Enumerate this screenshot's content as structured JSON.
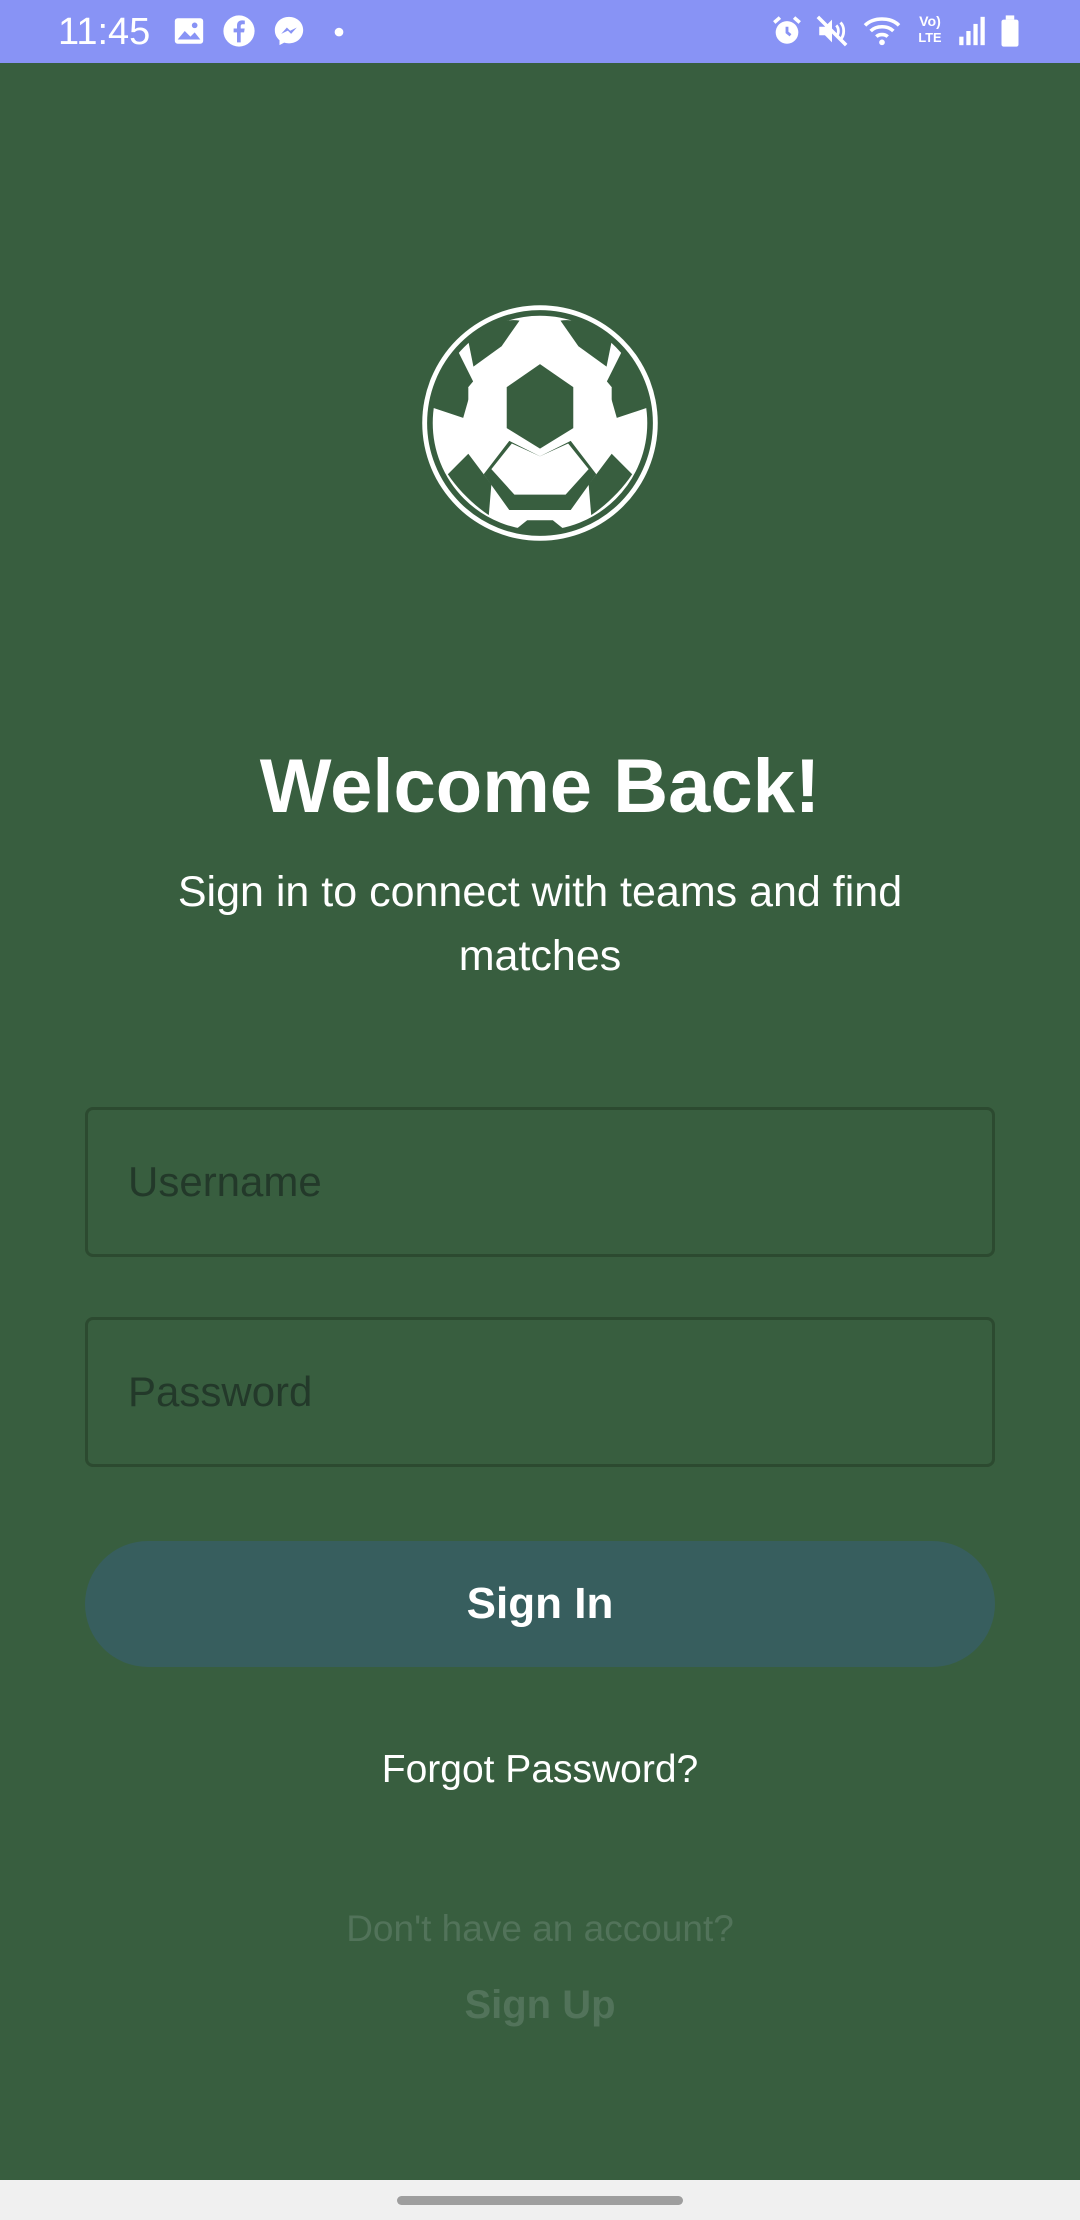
{
  "status_bar": {
    "time": "11:45",
    "left_icons": [
      "gallery-icon",
      "facebook-icon",
      "messenger-icon",
      "dot-icon"
    ],
    "right_icons": [
      "alarm-icon",
      "mute-icon",
      "wifi-icon",
      "volte-icon",
      "signal-icon",
      "battery-icon"
    ],
    "volte_label": "Vo) LTE",
    "background": "#8893F5"
  },
  "logo": {
    "icon": "soccer-ball-icon"
  },
  "header": {
    "title": "Welcome Back!",
    "subtitle": "Sign in to connect with teams and find matches"
  },
  "form": {
    "username_placeholder": "Username",
    "username_value": "",
    "password_placeholder": "Password",
    "password_value": "",
    "signin_label": "Sign In"
  },
  "links": {
    "forgot_password": "Forgot Password?",
    "no_account": "Don't have an account?",
    "signup": "Sign Up"
  },
  "colors": {
    "background": "#385E3F",
    "button": "#375E5E",
    "muted_text": "#52735A"
  }
}
